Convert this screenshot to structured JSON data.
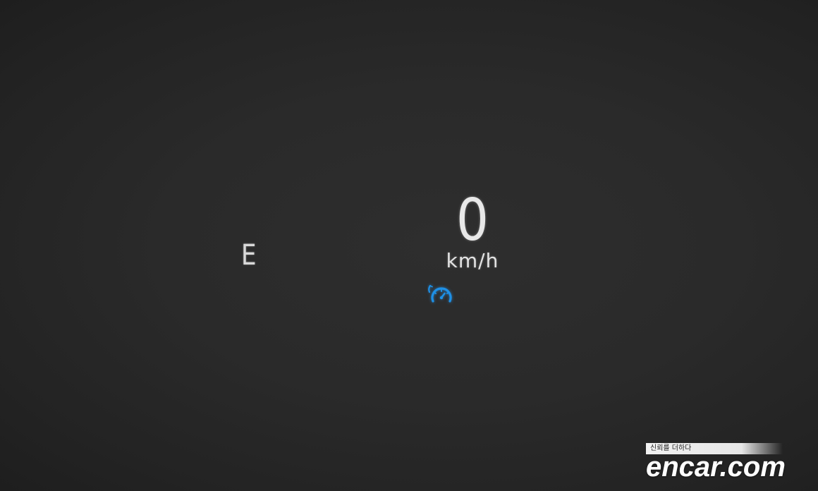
{
  "hud": {
    "gear": "E",
    "speed": {
      "value": "0",
      "unit": "km/h"
    },
    "indicator": {
      "icon": "cruise-control-icon",
      "color": "#1e90e6"
    }
  },
  "watermark": {
    "tagline": "신뢰를 더하다",
    "brand": "encar.com"
  }
}
